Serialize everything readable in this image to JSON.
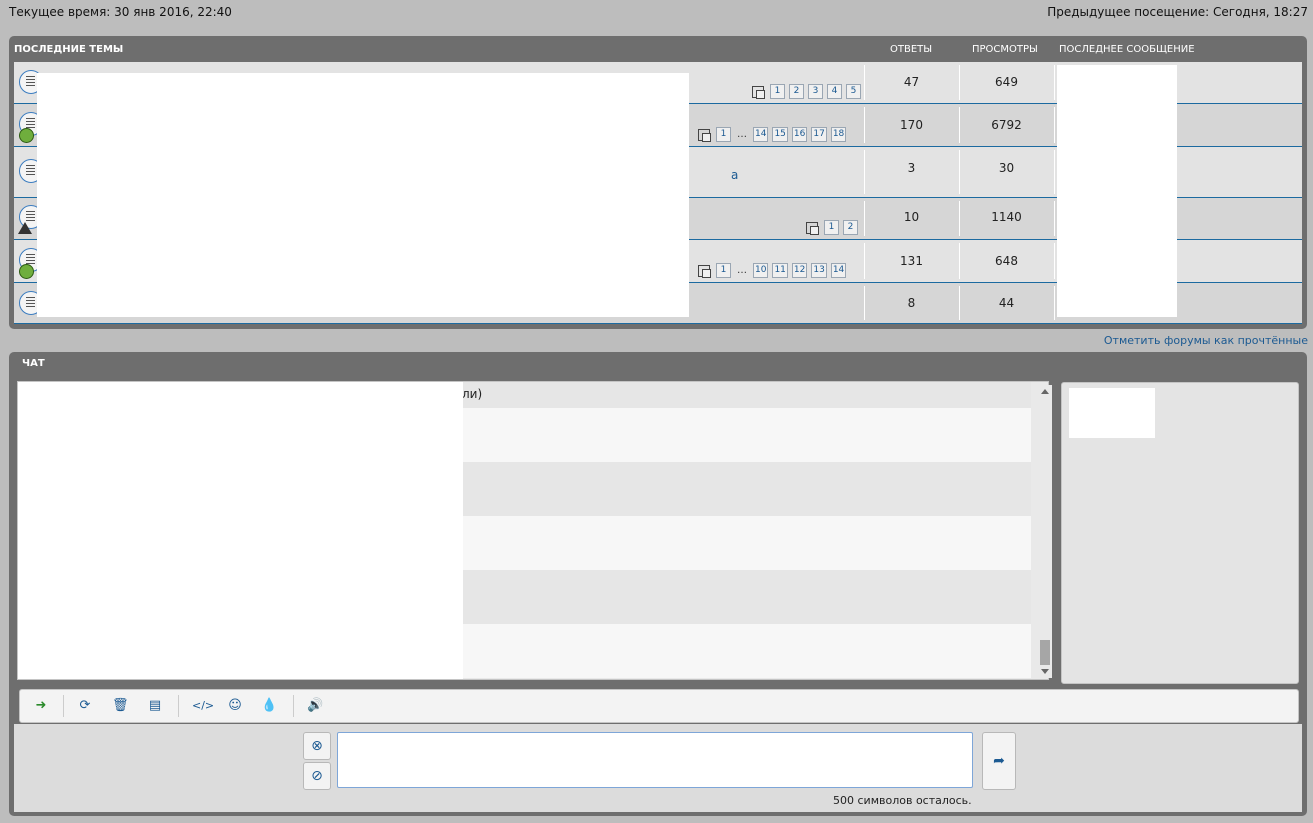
{
  "header": {
    "current_time": "Текущее время: 30 янв 2016, 22:40",
    "previous_visit": "Предыдущее посещение: Сегодня, 18:27"
  },
  "topics": {
    "title": "ПОСЛЕДНИЕ ТЕМЫ",
    "col_replies": "ОТВЕТЫ",
    "col_views": "ПРОСМОТРЫ",
    "col_last": "ПОСЛЕДНЕЕ СООБЩЕНИЕ",
    "rows": [
      {
        "replies": "47",
        "views": "649",
        "pages": [
          "1",
          "2",
          "3",
          "4",
          "5"
        ]
      },
      {
        "replies": "170",
        "views": "6792",
        "pages": [
          "1",
          "…",
          "14",
          "15",
          "16",
          "17",
          "18"
        ]
      },
      {
        "replies": "3",
        "views": "30",
        "pages": [],
        "fragment": "а"
      },
      {
        "replies": "10",
        "views": "1140",
        "pages": [
          "1",
          "2"
        ]
      },
      {
        "replies": "131",
        "views": "648",
        "pages": [
          "1",
          "…",
          "10",
          "11",
          "12",
          "13",
          "14"
        ]
      },
      {
        "replies": "8",
        "views": "44",
        "pages": []
      }
    ]
  },
  "mark_read": "Отметить форумы как прочтённые",
  "chat": {
    "title": "ЧАТ",
    "first_fragment": "ли)",
    "chars_left": "500 символов осталось.",
    "toolbar_icons": [
      "sign-in-icon",
      "refresh-icon",
      "trash-icon",
      "archive-icon",
      "code-icon",
      "smiley-icon",
      "color-drop-icon",
      "sound-icon"
    ]
  }
}
